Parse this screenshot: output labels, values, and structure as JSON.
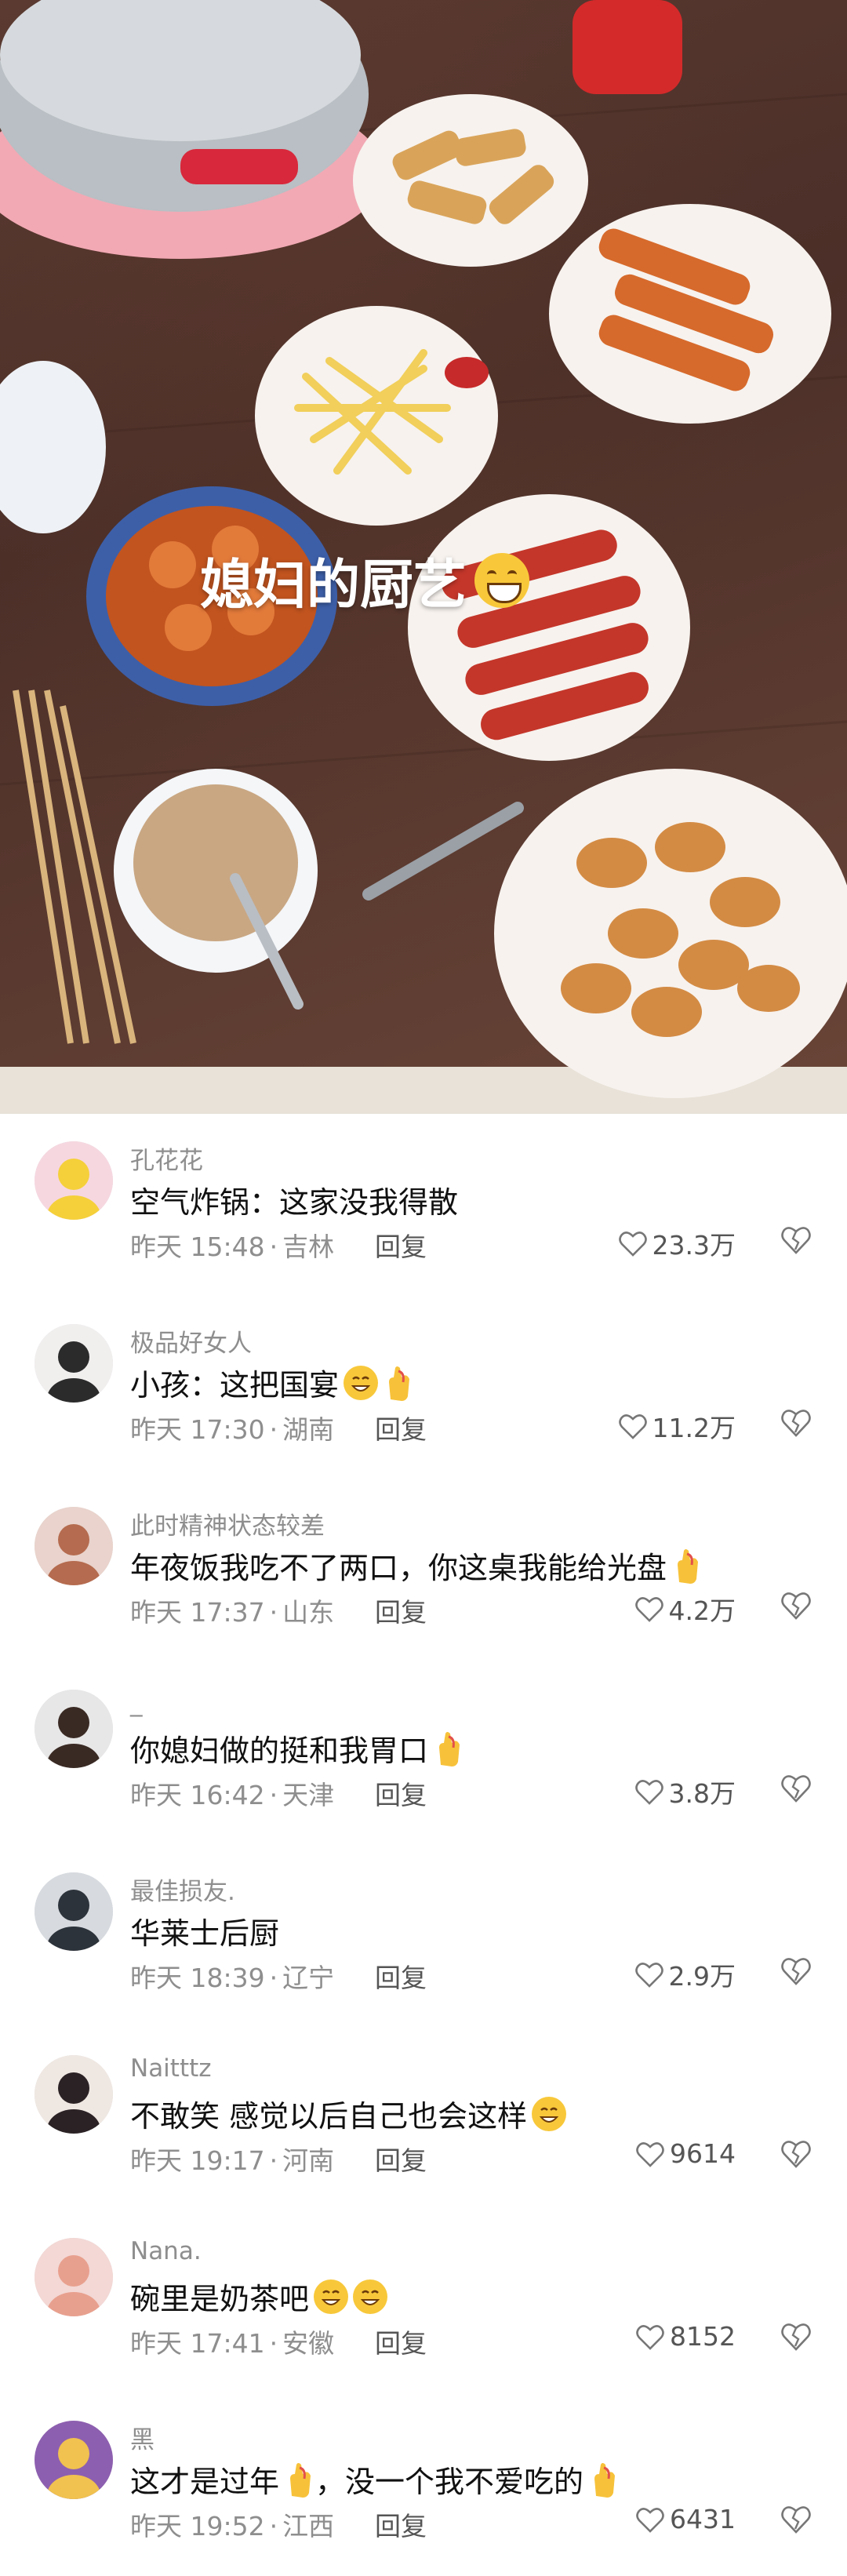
{
  "post": {
    "caption": "媳妇的厨艺",
    "caption_emoji": "grinning-face-emoji"
  },
  "comments": [
    {
      "username": "孔花花",
      "text": "空气炸锅：这家没我得散",
      "emojis": [],
      "time": "昨天 15:48",
      "location": "吉林",
      "reply": "回复",
      "likes": "23.3万"
    },
    {
      "username": "极品好女人",
      "text": "小孩：这把国宴",
      "emojis": [
        "laughing-face-emoji",
        "ok-hand-emoji"
      ],
      "time": "昨天 17:30",
      "location": "湖南",
      "reply": "回复",
      "likes": "11.2万"
    },
    {
      "username": "此时精神状态较差",
      "text": "年夜饭我吃不了两口，你这桌我能给光盘",
      "emojis": [
        "crossed-fingers-emoji"
      ],
      "time": "昨天 17:37",
      "location": "山东",
      "reply": "回复",
      "likes": "4.2万"
    },
    {
      "username": "_",
      "text": "你媳妇做的挺和我胃口",
      "emojis": [
        "crossed-fingers-emoji"
      ],
      "time": "昨天 16:42",
      "location": "天津",
      "reply": "回复",
      "likes": "3.8万"
    },
    {
      "username": "最佳损友.",
      "text": "华莱士后厨",
      "emojis": [],
      "time": "昨天 18:39",
      "location": "辽宁",
      "reply": "回复",
      "likes": "2.9万"
    },
    {
      "username": "Naitttz",
      "text": "不敢笑 感觉以后自己也会这样",
      "emojis": [
        "headphones-face-emoji"
      ],
      "time": "昨天 19:17",
      "location": "河南",
      "reply": "回复",
      "likes": "9614"
    },
    {
      "username": "Nana.",
      "text": "碗里是奶茶吧",
      "emojis": [
        "rolling-laughing-emoji",
        "rolling-laughing-emoji"
      ],
      "time": "昨天 17:41",
      "location": "安徽",
      "reply": "回复",
      "likes": "8152"
    },
    {
      "username": "黑",
      "text": "这才是过年",
      "text2": "，没一个我不爱吃的",
      "emojis": [
        "thumbs-up-emoji"
      ],
      "emojis2": [
        "crossed-fingers-emoji"
      ],
      "time": "昨天 19:52",
      "location": "江西",
      "reply": "回复",
      "likes": "6431"
    }
  ],
  "meta_separator": "·",
  "colors": {
    "meta_text": "#8e8e8e",
    "username": "#8e8e8e",
    "emoji_yellow": "#f8c83a"
  }
}
